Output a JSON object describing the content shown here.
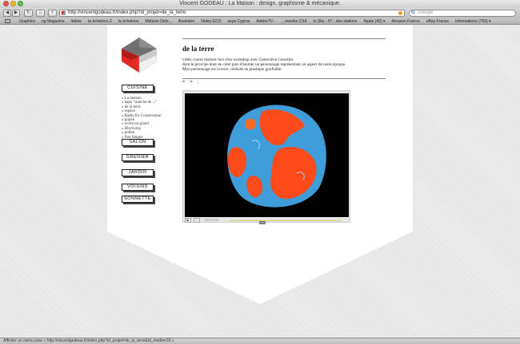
{
  "window": {
    "title": "Vincent GODEAU : La Maison : design, graphisme & mécanique."
  },
  "toolbar": {
    "back_label": "◀",
    "forward_label": "▶",
    "reload_label": "↻",
    "home_label": "⌂",
    "add_label": "+",
    "url": "http://vincentgodeau.fr/index.php?id_projet=de_la_terre",
    "search_placeholder": "Google",
    "search_engine_glyph": "G"
  },
  "bookmarks": [
    "Graphics",
    "ng Magazine",
    "lebloe",
    "ta échelons 2",
    "ta échelons",
    "Mélanie Delo...",
    "Illustrator",
    "Nokia 6210",
    "exps Cyprus",
    "AdobeTV -",
    "...eworks CS4",
    "In Situ - N°...des stations",
    "Apple (40) ▾",
    "Amazon France",
    "eBay France",
    "Informations (759) ▾"
  ],
  "sidebar": {
    "menu": {
      "cuisine": "CUISINE",
      "salon": "SALON",
      "grenier": "GRENIER",
      "jardin": "JARDIN",
      "voisins": "VOISINS",
      "sonnette": "SONNETTE"
    },
    "submenu": [
      "» La maison",
      "» tapis \"tranche de ...\"",
      "» de la terre",
      "» espèce",
      "» Radio En Construction",
      "» pojish",
      "» écrire en grand",
      "» Blockstop",
      "» pollen",
      "» free fatigue"
    ]
  },
  "project": {
    "title": "de la terre",
    "description": [
      "vidéo courte réalisée lors d'un workshop avec Geneviève Gauckler",
      "dont le principe était de créer puis d'animer un personnage représentant un aspect de notre époque.",
      "Mon personnage est la terre, réalisée en plastique gonflable."
    ],
    "pager": "< > ;"
  },
  "video": {
    "play_glyph": "▶",
    "fullscreen_glyph": "□",
    "time": "00:00:05",
    "progress": 0.29
  },
  "statusbar": {
    "text": "Afficher un menu pour « http://vincentgodeau.fr/index.php?id_projet=de_la_terre&id_media=33 »"
  },
  "colors": {
    "globe_blue": "#3f9ed9",
    "globe_orange": "#ff4a1a",
    "logo_red": "#e02a24"
  }
}
